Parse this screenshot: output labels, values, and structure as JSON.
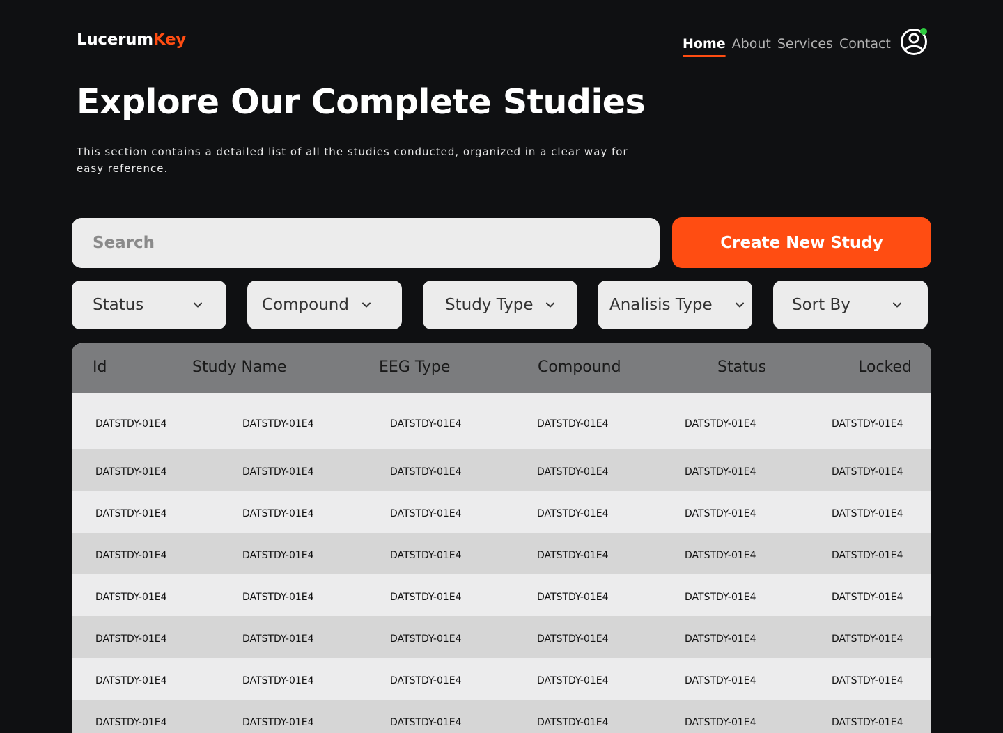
{
  "brand": {
    "name_part1": "Lucerum",
    "name_part2": "Key"
  },
  "nav": {
    "items": [
      {
        "label": "Home",
        "active": true
      },
      {
        "label": "About",
        "active": false
      },
      {
        "label": "Services",
        "active": false
      },
      {
        "label": "Contact",
        "active": false
      }
    ],
    "avatar_icon": "user-circle-icon",
    "status_color": "#2ecc40"
  },
  "hero": {
    "title": "Explore Our Complete Studies",
    "description": "This section contains a detailed list of all the studies conducted, organized in a clear way for easy reference."
  },
  "search": {
    "placeholder": "Search",
    "value": ""
  },
  "create_button": {
    "label": "Create New Study"
  },
  "filters": [
    {
      "label": "Status",
      "icon": "chevron-down-icon"
    },
    {
      "label": "Compound",
      "icon": "chevron-down-icon"
    },
    {
      "label": "Study Type",
      "icon": "chevron-down-icon"
    },
    {
      "label": "Analisis Type",
      "icon": "chevron-down-icon"
    },
    {
      "label": "Sort By",
      "icon": "chevron-down-icon"
    }
  ],
  "table": {
    "columns": [
      "Id",
      "Study Name",
      "EEG Type",
      "Compound",
      "Status",
      "Locked"
    ],
    "rows": [
      [
        "DATSTDY-01E4",
        "DATSTDY-01E4",
        "DATSTDY-01E4",
        "DATSTDY-01E4",
        "DATSTDY-01E4",
        "DATSTDY-01E4"
      ],
      [
        "DATSTDY-01E4",
        "DATSTDY-01E4",
        "DATSTDY-01E4",
        "DATSTDY-01E4",
        "DATSTDY-01E4",
        "DATSTDY-01E4"
      ],
      [
        "DATSTDY-01E4",
        "DATSTDY-01E4",
        "DATSTDY-01E4",
        "DATSTDY-01E4",
        "DATSTDY-01E4",
        "DATSTDY-01E4"
      ],
      [
        "DATSTDY-01E4",
        "DATSTDY-01E4",
        "DATSTDY-01E4",
        "DATSTDY-01E4",
        "DATSTDY-01E4",
        "DATSTDY-01E4"
      ],
      [
        "DATSTDY-01E4",
        "DATSTDY-01E4",
        "DATSTDY-01E4",
        "DATSTDY-01E4",
        "DATSTDY-01E4",
        "DATSTDY-01E4"
      ],
      [
        "DATSTDY-01E4",
        "DATSTDY-01E4",
        "DATSTDY-01E4",
        "DATSTDY-01E4",
        "DATSTDY-01E4",
        "DATSTDY-01E4"
      ],
      [
        "DATSTDY-01E4",
        "DATSTDY-01E4",
        "DATSTDY-01E4",
        "DATSTDY-01E4",
        "DATSTDY-01E4",
        "DATSTDY-01E4"
      ],
      [
        "DATSTDY-01E4",
        "DATSTDY-01E4",
        "DATSTDY-01E4",
        "DATSTDY-01E4",
        "DATSTDY-01E4",
        "DATSTDY-01E4"
      ]
    ]
  },
  "colors": {
    "accent": "#ff4d12",
    "background": "#0f1012",
    "header": "#7b7c7e",
    "row_alt": "#d6d6d6"
  }
}
